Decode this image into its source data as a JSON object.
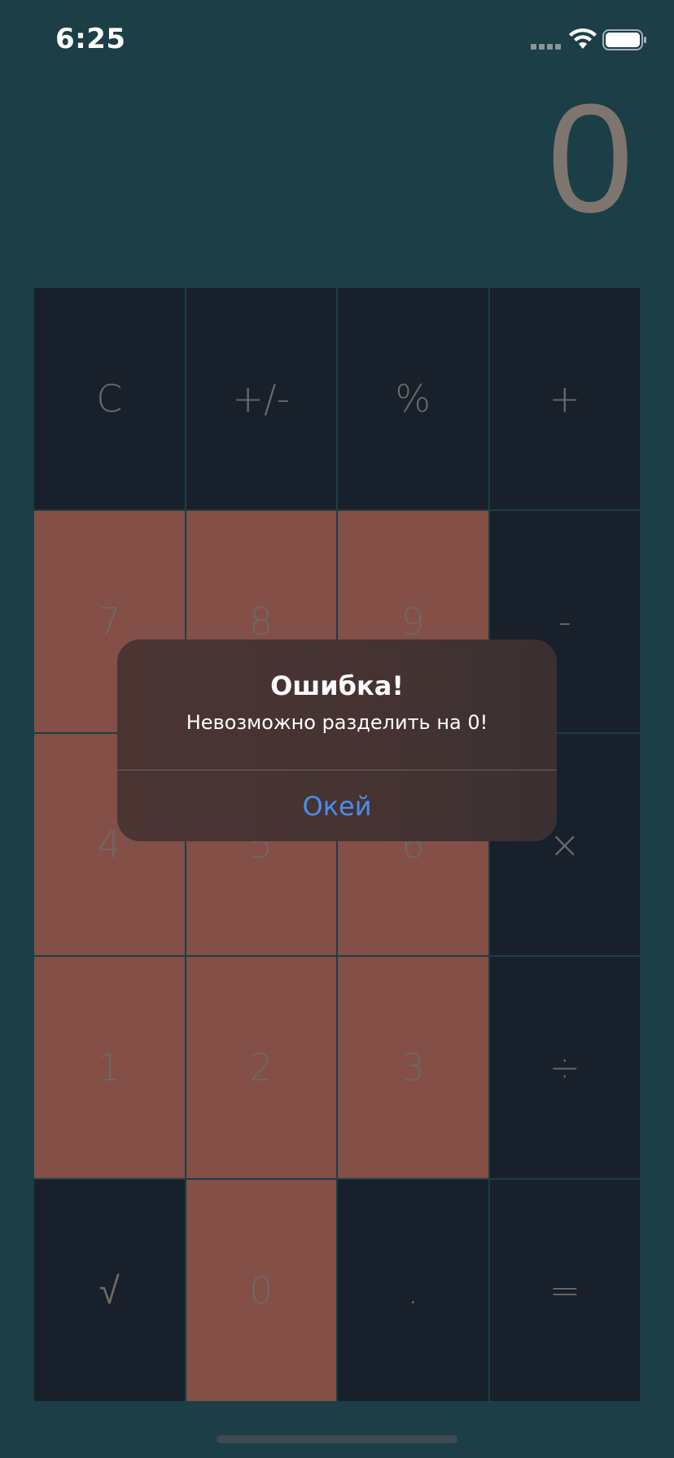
{
  "status_bar": {
    "time": "6:25"
  },
  "display": {
    "value": "0"
  },
  "keypad": {
    "keys": [
      {
        "label": "C",
        "style": "dark"
      },
      {
        "label": "+/-",
        "style": "dark"
      },
      {
        "label": "%",
        "style": "dark"
      },
      {
        "label": "+",
        "style": "dark"
      },
      {
        "label": "7",
        "style": "red"
      },
      {
        "label": "8",
        "style": "red"
      },
      {
        "label": "9",
        "style": "red"
      },
      {
        "label": "-",
        "style": "dark"
      },
      {
        "label": "4",
        "style": "red"
      },
      {
        "label": "5",
        "style": "red"
      },
      {
        "label": "6",
        "style": "red"
      },
      {
        "label": "×",
        "style": "dark"
      },
      {
        "label": "1",
        "style": "red"
      },
      {
        "label": "2",
        "style": "red"
      },
      {
        "label": "3",
        "style": "red"
      },
      {
        "label": "÷",
        "style": "dark"
      },
      {
        "label": "√",
        "style": "dark"
      },
      {
        "label": "0",
        "style": "red"
      },
      {
        "label": ".",
        "style": "dark"
      },
      {
        "label": "=",
        "style": "dark"
      }
    ]
  },
  "alert": {
    "title": "Ошибка!",
    "message": "Невозможно разделить на 0!",
    "button_label": "Окей"
  },
  "colors": {
    "background": "#1c3e46",
    "key_dark": "#17202b",
    "key_red": "#834f47",
    "alert_button": "#4a8df0"
  }
}
